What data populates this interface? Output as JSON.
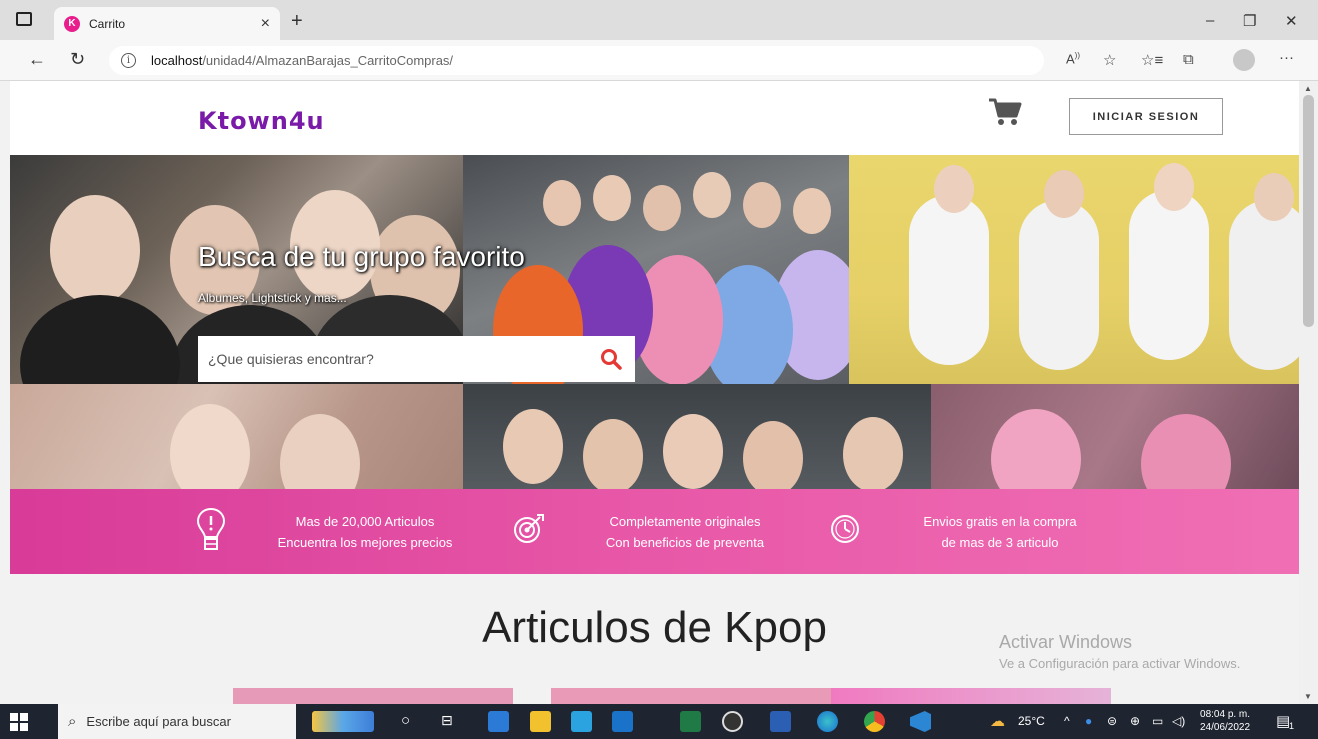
{
  "browser": {
    "tab_title": "Carrito",
    "tab_close": "×",
    "new_tab": "+",
    "url_host": "localhost",
    "url_path": "/unidad4/AlmazanBarajas_CarritoCompras/",
    "read_aloud": "A̧",
    "minimize": "–",
    "restore": "❐",
    "close": "✕",
    "more": "···"
  },
  "site": {
    "logo": "Ktown4u",
    "login_label": "INICIAR SESION",
    "hero_title": "Busca de tu grupo favorito",
    "hero_subtitle": "Albumes, Lightstick y mas...",
    "search_placeholder": "¿Que quisieras encontrar?",
    "features": [
      {
        "line1": "Mas de 20,000 Articulos",
        "line2": "Encuentra los mejores precios"
      },
      {
        "line1": "Completamente originales",
        "line2": "Con beneficios de preventa"
      },
      {
        "line1": "Envios gratis en la compra",
        "line2": "de mas de 3 articulo"
      }
    ],
    "section_title": "Articulos de Kpop"
  },
  "watermark": {
    "line1": "Activar Windows",
    "line2": "Ve a Configuración para activar Windows."
  },
  "taskbar": {
    "search_text": "Escribe aquí para buscar",
    "weather": "25°C",
    "time": "08:04 p. m.",
    "date": "24/06/2022",
    "notification_count": "1"
  },
  "colors": {
    "accent_pink": "#e24fa3",
    "logo_purple": "#7a1aa8",
    "search_red": "#e53935"
  }
}
